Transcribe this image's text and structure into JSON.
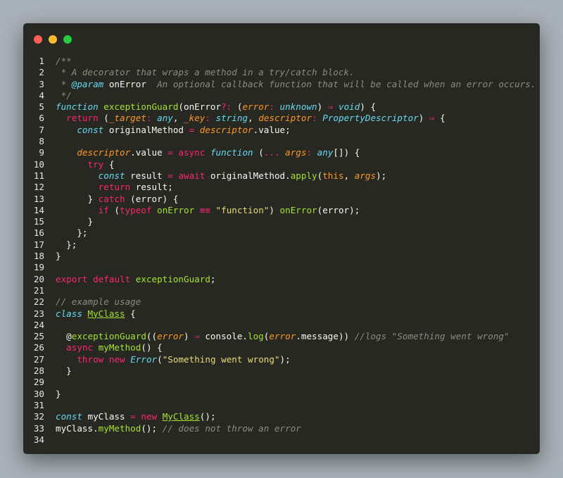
{
  "window": {
    "colors": {
      "background": "#272822",
      "red": "#ff5f56",
      "yellow": "#ffbd2e",
      "green": "#27c93f"
    }
  },
  "code": {
    "line_numbers": [
      "1",
      "2",
      "3",
      "4",
      "5",
      "6",
      "7",
      "8",
      "9",
      "10",
      "11",
      "12",
      "13",
      "14",
      "15",
      "16",
      "17",
      "18",
      "19",
      "20",
      "21",
      "22",
      "23",
      "24",
      "25",
      "26",
      "27",
      "28",
      "29",
      "30",
      "31",
      "32",
      "33",
      "34"
    ],
    "lines": [
      [
        [
          "cm",
          "/**"
        ]
      ],
      [
        [
          "cm",
          " * A decorator that wraps a method in a try/catch block."
        ]
      ],
      [
        [
          "cm",
          " * "
        ],
        [
          "tag",
          "@param"
        ],
        [
          "pl",
          " onError"
        ],
        [
          "cm",
          "  An optional callback function that will be called when an error occurs."
        ]
      ],
      [
        [
          "cm",
          " */"
        ]
      ],
      [
        [
          "kwi",
          "function"
        ],
        [
          "pl",
          " "
        ],
        [
          "fn",
          "exceptionGuard"
        ],
        [
          "pl",
          "(onError"
        ],
        [
          "kw",
          "?:"
        ],
        [
          "pl",
          " ("
        ],
        [
          "pr",
          "error"
        ],
        [
          "kw",
          ":"
        ],
        [
          "pl",
          " "
        ],
        [
          "ty",
          "unknown"
        ],
        [
          "pl",
          ") "
        ],
        [
          "kw",
          "⇒"
        ],
        [
          "pl",
          " "
        ],
        [
          "ty",
          "void"
        ],
        [
          "pl",
          ") {"
        ]
      ],
      [
        [
          "pl",
          "  "
        ],
        [
          "kw",
          "return"
        ],
        [
          "pl",
          " ("
        ],
        [
          "pr",
          "_target"
        ],
        [
          "kw",
          ":"
        ],
        [
          "pl",
          " "
        ],
        [
          "ty",
          "any"
        ],
        [
          "pl",
          ", "
        ],
        [
          "pr",
          "_key"
        ],
        [
          "kw",
          ":"
        ],
        [
          "pl",
          " "
        ],
        [
          "ty",
          "string"
        ],
        [
          "pl",
          ", "
        ],
        [
          "pr",
          "descriptor"
        ],
        [
          "kw",
          ":"
        ],
        [
          "pl",
          " "
        ],
        [
          "ty",
          "PropertyDescriptor"
        ],
        [
          "pl",
          ") "
        ],
        [
          "kw",
          "⇒"
        ],
        [
          "pl",
          " {"
        ]
      ],
      [
        [
          "pl",
          "    "
        ],
        [
          "kwi",
          "const"
        ],
        [
          "pl",
          " originalMethod "
        ],
        [
          "kw",
          "="
        ],
        [
          "pl",
          " "
        ],
        [
          "pr",
          "descriptor"
        ],
        [
          "pl",
          ".value;"
        ]
      ],
      [],
      [
        [
          "pl",
          "    "
        ],
        [
          "pr",
          "descriptor"
        ],
        [
          "pl",
          ".value "
        ],
        [
          "kw",
          "="
        ],
        [
          "pl",
          " "
        ],
        [
          "kw",
          "async"
        ],
        [
          "pl",
          " "
        ],
        [
          "kwi",
          "function"
        ],
        [
          "pl",
          " ("
        ],
        [
          "kw",
          "..."
        ],
        [
          "pl",
          " "
        ],
        [
          "pr",
          "args"
        ],
        [
          "kw",
          ":"
        ],
        [
          "pl",
          " "
        ],
        [
          "ty",
          "any"
        ],
        [
          "pl",
          "[]) {"
        ]
      ],
      [
        [
          "pl",
          "      "
        ],
        [
          "kw",
          "try"
        ],
        [
          "pl",
          " {"
        ]
      ],
      [
        [
          "pl",
          "        "
        ],
        [
          "kwi",
          "const"
        ],
        [
          "pl",
          " result "
        ],
        [
          "kw",
          "="
        ],
        [
          "pl",
          " "
        ],
        [
          "kw",
          "await"
        ],
        [
          "pl",
          " originalMethod."
        ],
        [
          "fn",
          "apply"
        ],
        [
          "pl",
          "("
        ],
        [
          "th",
          "this"
        ],
        [
          "pl",
          ", "
        ],
        [
          "pr",
          "args"
        ],
        [
          "pl",
          ");"
        ]
      ],
      [
        [
          "pl",
          "        "
        ],
        [
          "kw",
          "return"
        ],
        [
          "pl",
          " result;"
        ]
      ],
      [
        [
          "pl",
          "      } "
        ],
        [
          "kw",
          "catch"
        ],
        [
          "pl",
          " (error) {"
        ]
      ],
      [
        [
          "pl",
          "        "
        ],
        [
          "kw",
          "if"
        ],
        [
          "pl",
          " ("
        ],
        [
          "kw",
          "typeof"
        ],
        [
          "pl",
          " "
        ],
        [
          "fn",
          "onError"
        ],
        [
          "pl",
          " "
        ],
        [
          "kw",
          "≡≡"
        ],
        [
          "pl",
          " "
        ],
        [
          "st",
          "\"function\""
        ],
        [
          "pl",
          ") "
        ],
        [
          "fn",
          "onError"
        ],
        [
          "pl",
          "(error);"
        ]
      ],
      [
        [
          "pl",
          "      }"
        ]
      ],
      [
        [
          "pl",
          "    };"
        ]
      ],
      [
        [
          "pl",
          "  };"
        ]
      ],
      [
        [
          "pl",
          "}"
        ]
      ],
      [],
      [
        [
          "kw",
          "export"
        ],
        [
          "pl",
          " "
        ],
        [
          "kw",
          "default"
        ],
        [
          "pl",
          " "
        ],
        [
          "fn",
          "exceptionGuard"
        ],
        [
          "pl",
          ";"
        ]
      ],
      [],
      [
        [
          "cm",
          "// example usage"
        ]
      ],
      [
        [
          "kwi",
          "class"
        ],
        [
          "pl",
          " "
        ],
        [
          "cls",
          "MyClass"
        ],
        [
          "pl",
          " {"
        ]
      ],
      [],
      [
        [
          "pl",
          "  @"
        ],
        [
          "fn",
          "exceptionGuard"
        ],
        [
          "pl",
          "(("
        ],
        [
          "pr",
          "error"
        ],
        [
          "pl",
          ") "
        ],
        [
          "kw",
          "⇒"
        ],
        [
          "pl",
          " console."
        ],
        [
          "fn",
          "log"
        ],
        [
          "pl",
          "("
        ],
        [
          "pr",
          "error"
        ],
        [
          "pl",
          ".message)) "
        ],
        [
          "cm",
          "//logs \"Something went wrong\""
        ]
      ],
      [
        [
          "pl",
          "  "
        ],
        [
          "kw",
          "async"
        ],
        [
          "pl",
          " "
        ],
        [
          "fn",
          "myMethod"
        ],
        [
          "pl",
          "() {"
        ]
      ],
      [
        [
          "pl",
          "    "
        ],
        [
          "kw",
          "throw"
        ],
        [
          "pl",
          " "
        ],
        [
          "kw",
          "new"
        ],
        [
          "pl",
          " "
        ],
        [
          "ty",
          "Error"
        ],
        [
          "pl",
          "("
        ],
        [
          "st",
          "\"Something went wrong\""
        ],
        [
          "pl",
          ");"
        ]
      ],
      [
        [
          "pl",
          "  }"
        ]
      ],
      [],
      [
        [
          "pl",
          "}"
        ]
      ],
      [],
      [
        [
          "kwi",
          "const"
        ],
        [
          "pl",
          " myClass "
        ],
        [
          "kw",
          "="
        ],
        [
          "pl",
          " "
        ],
        [
          "kw",
          "new"
        ],
        [
          "pl",
          " "
        ],
        [
          "cls",
          "MyClass"
        ],
        [
          "pl",
          "();"
        ]
      ],
      [
        [
          "pl",
          "myClass."
        ],
        [
          "fn",
          "myMethod"
        ],
        [
          "pl",
          "(); "
        ],
        [
          "cm",
          "// does not throw an error"
        ]
      ],
      []
    ]
  }
}
